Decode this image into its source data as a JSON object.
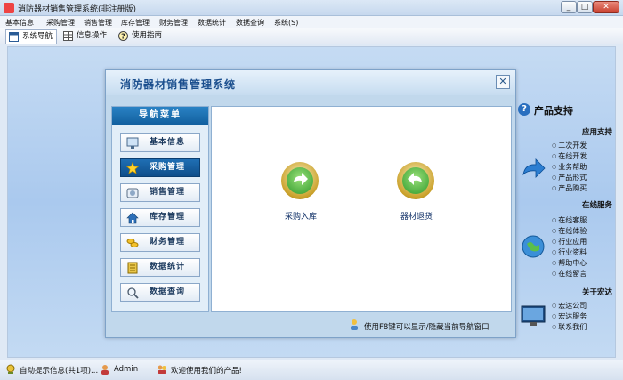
{
  "window": {
    "title": "消防器材销售管理系统(非注册版)"
  },
  "menu": [
    "基本信息",
    "采购管理",
    "销售管理",
    "库存管理",
    "财务管理",
    "数据统计",
    "数据查询",
    "系统(S)"
  ],
  "toolbar": {
    "tabs": [
      {
        "label": "系统导航",
        "active": true
      },
      {
        "label": "信息操作",
        "active": false
      },
      {
        "label": "使用指南",
        "active": false
      }
    ]
  },
  "dialog": {
    "title": "消防器材销售管理系统",
    "close_symbol": "✕",
    "nav": {
      "header": "导航菜单",
      "items": [
        {
          "label": "基本信息",
          "icon": "monitor-icon",
          "active": false
        },
        {
          "label": "采购管理",
          "icon": "star-icon",
          "active": true
        },
        {
          "label": "销售管理",
          "icon": "cart-icon",
          "active": false
        },
        {
          "label": "库存管理",
          "icon": "house-icon",
          "active": false
        },
        {
          "label": "财务管理",
          "icon": "coins-icon",
          "active": false
        },
        {
          "label": "数据统计",
          "icon": "ledger-icon",
          "active": false
        },
        {
          "label": "数据查询",
          "icon": "magnifier-icon",
          "active": false
        }
      ]
    },
    "actions": [
      {
        "label": "采购入库",
        "icon": "arrow-right-icon"
      },
      {
        "label": "器材退货",
        "icon": "arrow-left-icon"
      }
    ],
    "footer_hint": "使用F8键可以显示/隐藏当前导航窗口"
  },
  "side": {
    "title": "产品支持",
    "sections": [
      {
        "title": "应用支持",
        "links": [
          "二次开发",
          "在线开发",
          "业务帮助",
          "产品形式",
          "产品购买"
        ]
      },
      {
        "title": "在线服务",
        "links": [
          "在线客服",
          "在线体验",
          "行业应用",
          "行业资料",
          "帮助中心",
          "在线留言"
        ]
      },
      {
        "title": "关于宏达",
        "links": [
          "宏达公司",
          "宏达服务",
          "联系我们"
        ]
      }
    ]
  },
  "status": {
    "notice": "自动提示信息(共1项)...",
    "user": "Admin",
    "welcome": "欢迎使用我们的产品!"
  },
  "colors": {
    "accent": "#12609f",
    "nav_active": "#1f6fb4",
    "title_blue": "#1b4f8e"
  }
}
